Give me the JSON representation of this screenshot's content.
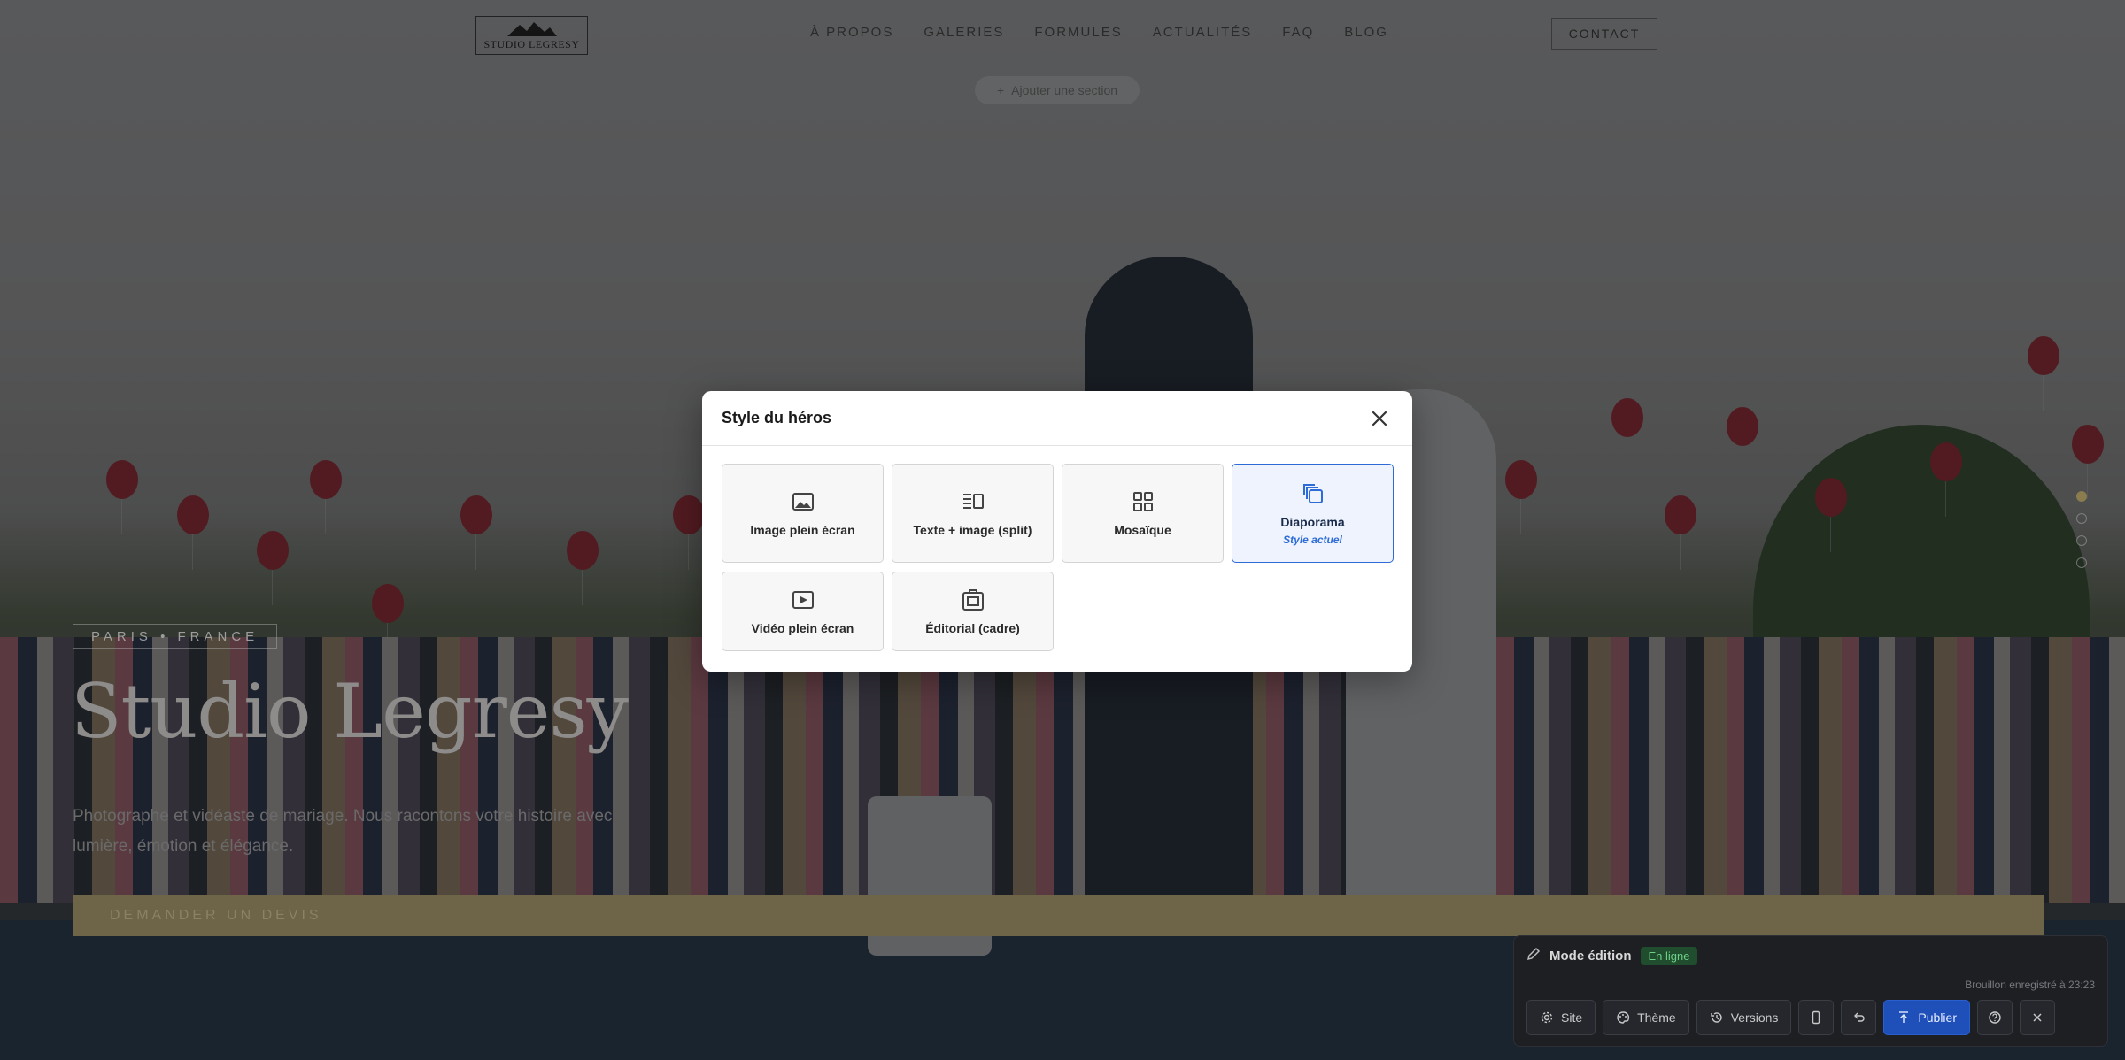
{
  "nav": {
    "logo_text": "STUDIO LEGRESY",
    "items": [
      {
        "label": "À PROPOS"
      },
      {
        "label": "GALERIES"
      },
      {
        "label": "FORMULES"
      },
      {
        "label": "ACTUALITÉS"
      },
      {
        "label": "FAQ"
      },
      {
        "label": "BLOG"
      }
    ],
    "contact_label": "CONTACT"
  },
  "add_section_label": "Ajouter une section",
  "hero": {
    "tag": "PARIS • FRANCE",
    "title": "Studio Legresy",
    "subtitle": "Photographe et vidéaste de mariage. Nous racontons votre histoire avec lumière, émotion et élégance.",
    "cta": "DEMANDER UN DEVIS",
    "slides_total": 4,
    "slide_active": 1
  },
  "modal": {
    "title": "Style du héros",
    "options": [
      {
        "label": "Image plein écran",
        "icon": "image-icon"
      },
      {
        "label": "Texte + image (split)",
        "icon": "split-layout-icon"
      },
      {
        "label": "Mosaïque",
        "icon": "grid-icon"
      },
      {
        "label": "Diaporama",
        "icon": "slides-icon",
        "selected": true,
        "note": "Style actuel"
      },
      {
        "label": "Vidéo plein écran",
        "icon": "video-icon"
      },
      {
        "label": "Éditorial (cadre)",
        "icon": "frame-icon"
      }
    ]
  },
  "editor": {
    "title": "Mode édition",
    "status": "En ligne",
    "saved_text": "Brouillon enregistré à 23:23",
    "buttons": {
      "site": "Site",
      "theme": "Thème",
      "versions": "Versions",
      "publish": "Publier"
    }
  },
  "colors": {
    "accent": "#2d6bd6",
    "gold": "#8a7c4e",
    "online_badge": "#6fcf8a"
  }
}
